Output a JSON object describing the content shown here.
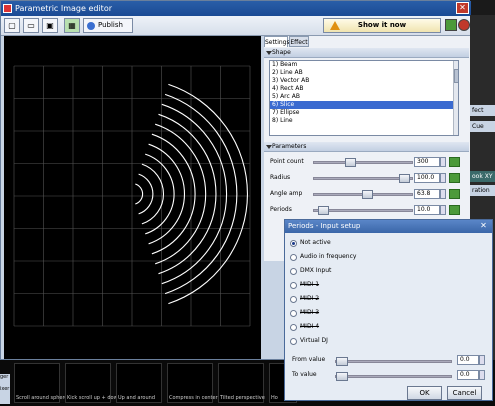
{
  "window": {
    "title": "Parametric Image editor"
  },
  "toolbar": {
    "publish_label": "Publish",
    "show_label": "Show it now"
  },
  "tabs": [
    "Settings",
    "Effect"
  ],
  "shape": {
    "header": "Shape",
    "items": [
      "1) Beam",
      "2) Line AB",
      "3) Vector AB",
      "4) Rect AB",
      "5) Arc AB",
      "6) Slice",
      "7) Ellipse",
      "8) Line"
    ],
    "selected_index": 5
  },
  "parameters": {
    "header": "Parameters",
    "rows": [
      {
        "label": "Point count",
        "value": "300",
        "level": 0.35
      },
      {
        "label": "Radius",
        "value": "100.0",
        "level": 0.97
      },
      {
        "label": "Angle amp",
        "value": "63.8",
        "level": 0.55
      },
      {
        "label": "Periods",
        "value": "10.0",
        "level": 0.04
      }
    ]
  },
  "side": [
    "fect",
    "Cue",
    "ook XY",
    "ration"
  ],
  "thumbnails": [
    "Scroll around sphere",
    "Kick scroll up + down",
    "Up and around",
    "Compress in center",
    "Tilted perspective",
    "Ho"
  ],
  "dialog": {
    "title": "Periods - Input setup",
    "options": [
      "Not active",
      "Audio in frequency",
      "DMX Input",
      "MIDI 1",
      "MIDI 2",
      "MIDI 3",
      "MIDI 4",
      "Virtual DJ"
    ],
    "selected_index": 0,
    "from_label": "From value",
    "from_value": "0.0",
    "to_label": "To value",
    "to_value": "0.0",
    "ok_label": "OK",
    "cancel_label": "Cancel"
  },
  "left_edge": [
    "ger",
    "ixer"
  ]
}
